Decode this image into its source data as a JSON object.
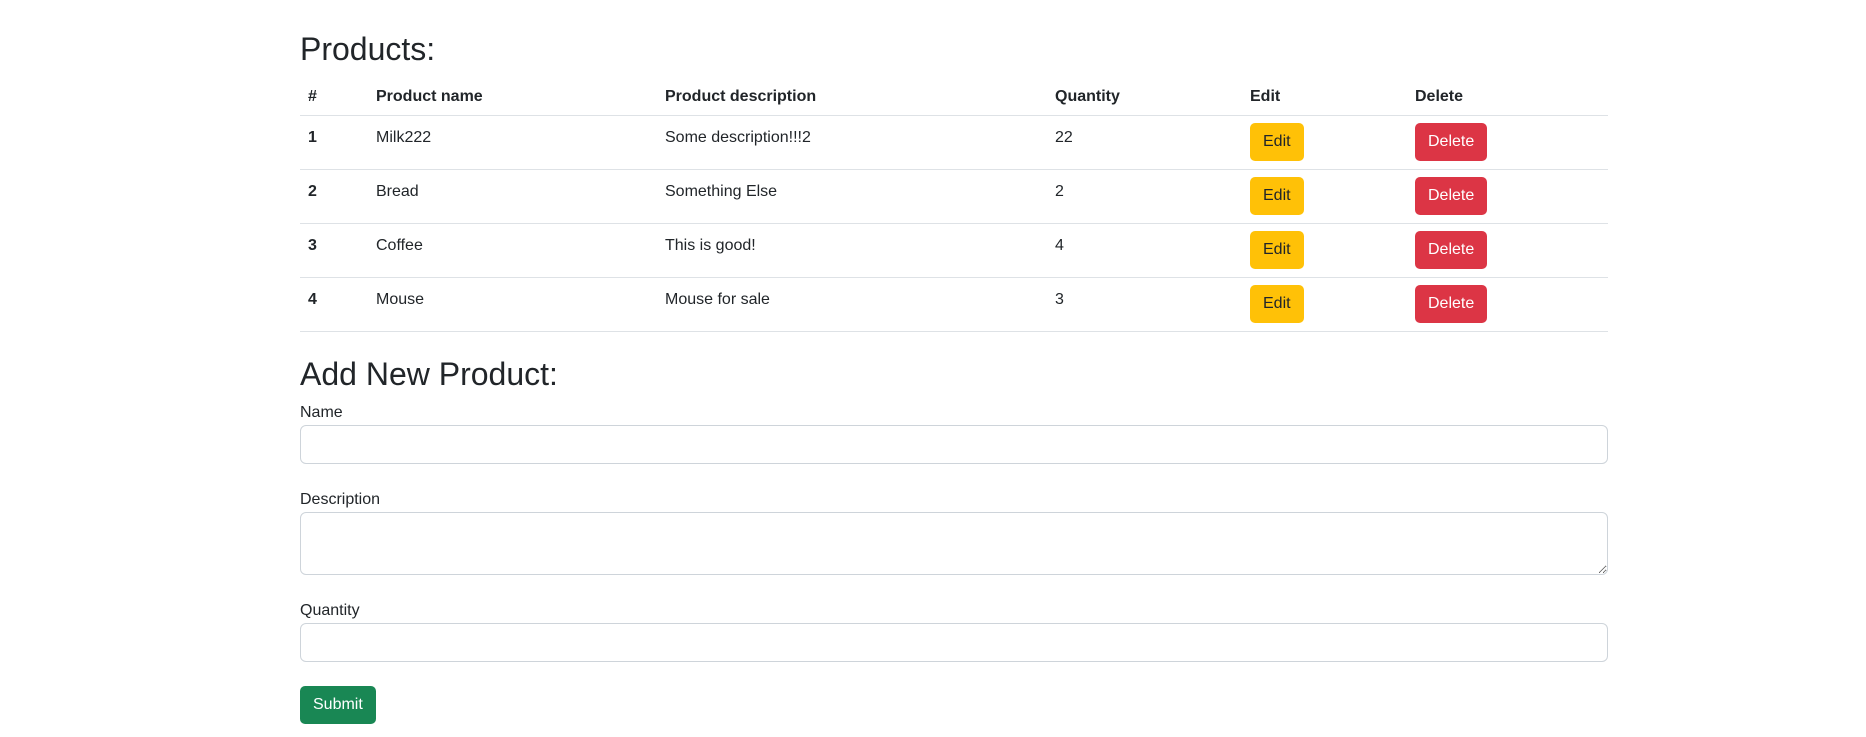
{
  "products_title": "Products:",
  "table": {
    "headers": [
      "#",
      "Product name",
      "Product description",
      "Quantity",
      "Edit",
      "Delete"
    ],
    "rows": [
      {
        "index": "1",
        "name": "Milk222",
        "description": "Some description!!!2",
        "quantity": "22",
        "edit_label": "Edit",
        "delete_label": "Delete"
      },
      {
        "index": "2",
        "name": "Bread",
        "description": "Something Else",
        "quantity": "2",
        "edit_label": "Edit",
        "delete_label": "Delete"
      },
      {
        "index": "3",
        "name": "Coffee",
        "description": "This is good!",
        "quantity": "4",
        "edit_label": "Edit",
        "delete_label": "Delete"
      },
      {
        "index": "4",
        "name": "Mouse",
        "description": "Mouse for sale",
        "quantity": "3",
        "edit_label": "Edit",
        "delete_label": "Delete"
      }
    ]
  },
  "form": {
    "title": "Add New Product:",
    "name_label": "Name",
    "name_value": "",
    "description_label": "Description",
    "description_value": "",
    "quantity_label": "Quantity",
    "quantity_value": "",
    "submit_label": "Submit"
  },
  "colors": {
    "edit_button": "#ffc107",
    "delete_button": "#dc3545",
    "submit_button": "#198754"
  }
}
